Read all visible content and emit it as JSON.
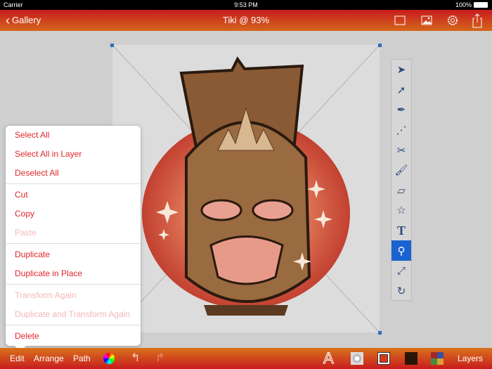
{
  "status": {
    "carrier": "Carrier",
    "time": "9:53 PM",
    "battery": "100%"
  },
  "nav": {
    "back_label": "Gallery",
    "title": "Tiki @ 93%",
    "icons": [
      "fit-screen-icon",
      "image-icon",
      "gear-icon",
      "share-icon"
    ]
  },
  "tools": [
    "select-arrow",
    "direct-select",
    "pen",
    "add-node",
    "scissors",
    "brush",
    "eraser",
    "star-shape",
    "text",
    "eyedropper",
    "scale",
    "rotate"
  ],
  "tool_active": "eyedropper",
  "menu": {
    "items": [
      {
        "label": "Select All",
        "enabled": true
      },
      {
        "label": "Select All in Layer",
        "enabled": true
      },
      {
        "label": "Deselect All",
        "enabled": true
      },
      {
        "label": "Cut",
        "enabled": true
      },
      {
        "label": "Copy",
        "enabled": true
      },
      {
        "label": "Paste",
        "enabled": false
      },
      {
        "label": "Duplicate",
        "enabled": true
      },
      {
        "label": "Duplicate in Place",
        "enabled": true
      },
      {
        "label": "Transform Again",
        "enabled": false
      },
      {
        "label": "Duplicate and Transform Again",
        "enabled": false
      },
      {
        "label": "Delete",
        "enabled": true
      }
    ]
  },
  "toolbar": {
    "edit": "Edit",
    "arrange": "Arrange",
    "path": "Path",
    "layers": "Layers",
    "fill_color": "#2a1508"
  },
  "colors": {
    "accent": "#e0262a",
    "tool_active": "#1a63d0"
  }
}
